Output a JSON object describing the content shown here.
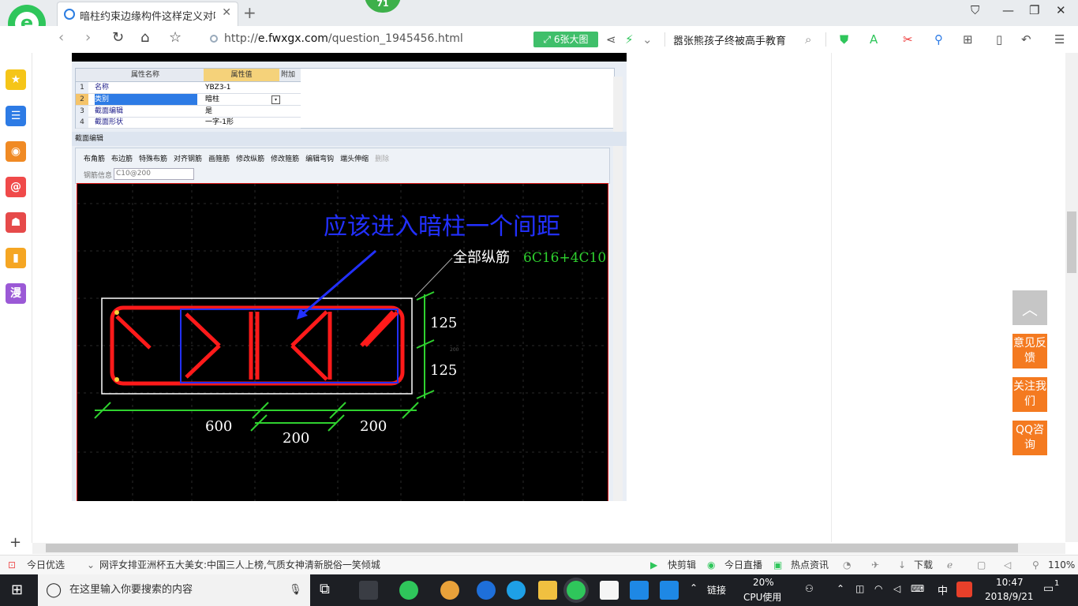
{
  "browser": {
    "tab_title": "暗柱约束边缘构件这样定义对吗?",
    "tab_badge": "71",
    "url_prefix": "http://",
    "url_domain": "e.fwxgx.com",
    "url_path": "/question_1945456.html",
    "big_image_label": "6张大图",
    "search_text": "嚣张熊孩子终被高手教育",
    "logo_letter": "e",
    "brand_color": "#2fc65b"
  },
  "sidebar": {
    "items": [
      {
        "icon": "star-icon",
        "glyph": "★",
        "color": "#f5c518"
      },
      {
        "icon": "news-icon",
        "glyph": "☰",
        "color": "#2d7be5"
      },
      {
        "icon": "weibo-icon",
        "glyph": "◉",
        "color": "#f08a24"
      },
      {
        "icon": "mail-icon",
        "glyph": "@",
        "color": "#f04a4a"
      },
      {
        "icon": "game-icon",
        "glyph": "☗",
        "color": "#e64a4a"
      },
      {
        "icon": "book-icon",
        "glyph": "▮",
        "color": "#f5a623"
      },
      {
        "icon": "comic-icon",
        "glyph": "漫",
        "color": "#9b59d6"
      }
    ],
    "add_label": "+"
  },
  "app": {
    "prop_header_name": "属性名称",
    "prop_header_value": "属性值",
    "prop_header_extra": "附加",
    "rows": [
      {
        "n": "1",
        "k": "名称",
        "v": "YBZ3-1"
      },
      {
        "n": "2",
        "k": "类别",
        "v": "暗柱"
      },
      {
        "n": "3",
        "k": "截面编辑",
        "v": "是"
      },
      {
        "n": "4",
        "k": "截面形状",
        "v": "一字-1形"
      }
    ],
    "section_title": "截面编辑",
    "tools": [
      "布角筋",
      "布边筋",
      "特殊布筋",
      "对齐钢筋",
      "画箍筋",
      "修改纵筋",
      "修改箍筋",
      "编辑弯钩",
      "端头伸缩",
      "删除"
    ],
    "rebar_label": "钢筋信息",
    "rebar_value": "C10@200"
  },
  "drawing": {
    "annotation": "应该进入暗柱一个间距",
    "rebar_prefix": "全部纵筋",
    "rebar_spec": "6C16+4C10",
    "dim_right_top": "125",
    "dim_right_bottom": "125",
    "dim_bottom_left": "600",
    "dim_bottom_mid": "200",
    "dim_bottom_right": "200",
    "tiny_label": "200"
  },
  "right_panel": {
    "feedback": "意见反馈",
    "follow": "关注我们",
    "qq": "QQ咨询"
  },
  "status": {
    "today_label": "今日优选",
    "news": "网评女排亚洲杯五大美女:中国三人上榜,气质女神清新脱俗一笑倾城",
    "quick_clip": "快剪辑",
    "live": "今日直播",
    "hot": "热点资讯",
    "download": "下载",
    "zoom": "110%"
  },
  "taskbar": {
    "search_placeholder": "在这里输入你要搜索的内容",
    "link_label": "链接",
    "cpu_percent": "20%",
    "cpu_label": "CPU使用",
    "ime": "中",
    "time": "10:47",
    "date": "2018/9/21",
    "notif": "1"
  }
}
